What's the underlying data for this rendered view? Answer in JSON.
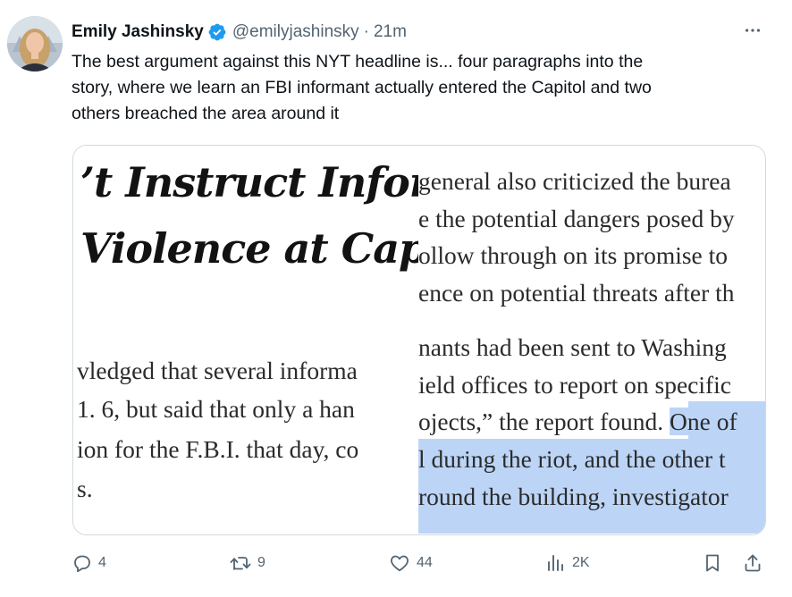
{
  "author": {
    "name": "Emily Jashinsky",
    "handle": "@emilyjashinsky",
    "separator": "·",
    "time": "21m"
  },
  "tweet": {
    "lines": [
      "The best argument against this NYT headline is... four paragraphs into the",
      "story, where we learn an FBI informant actually entered the Capitol and two",
      "others breached the area around it"
    ]
  },
  "media": {
    "left": {
      "headline_lines": [
        "’t Instruct Inform",
        "Violence at Capi"
      ],
      "body_lines": [
        "vledged that several informa",
        "1. 6, but said that only a han",
        "ion for the F.B.I. that day, co",
        "s."
      ]
    },
    "right": {
      "lines": [
        "general also criticized the burea",
        "e the potential dangers posed by",
        "ollow through on its promise to",
        "ence on potential threats after th",
        "nants had been sent to Washing",
        "ield offices to report on specific",
        "ojects,” the report found. ",
        "One of",
        "l during the riot, and the other t",
        "round the building, investigator"
      ]
    }
  },
  "actions": {
    "replies": "4",
    "reposts": "9",
    "likes": "44",
    "views": "2K"
  },
  "colors": {
    "verified": "#1d9bf0",
    "highlight": "#bcd5f7",
    "muted": "#536471"
  }
}
